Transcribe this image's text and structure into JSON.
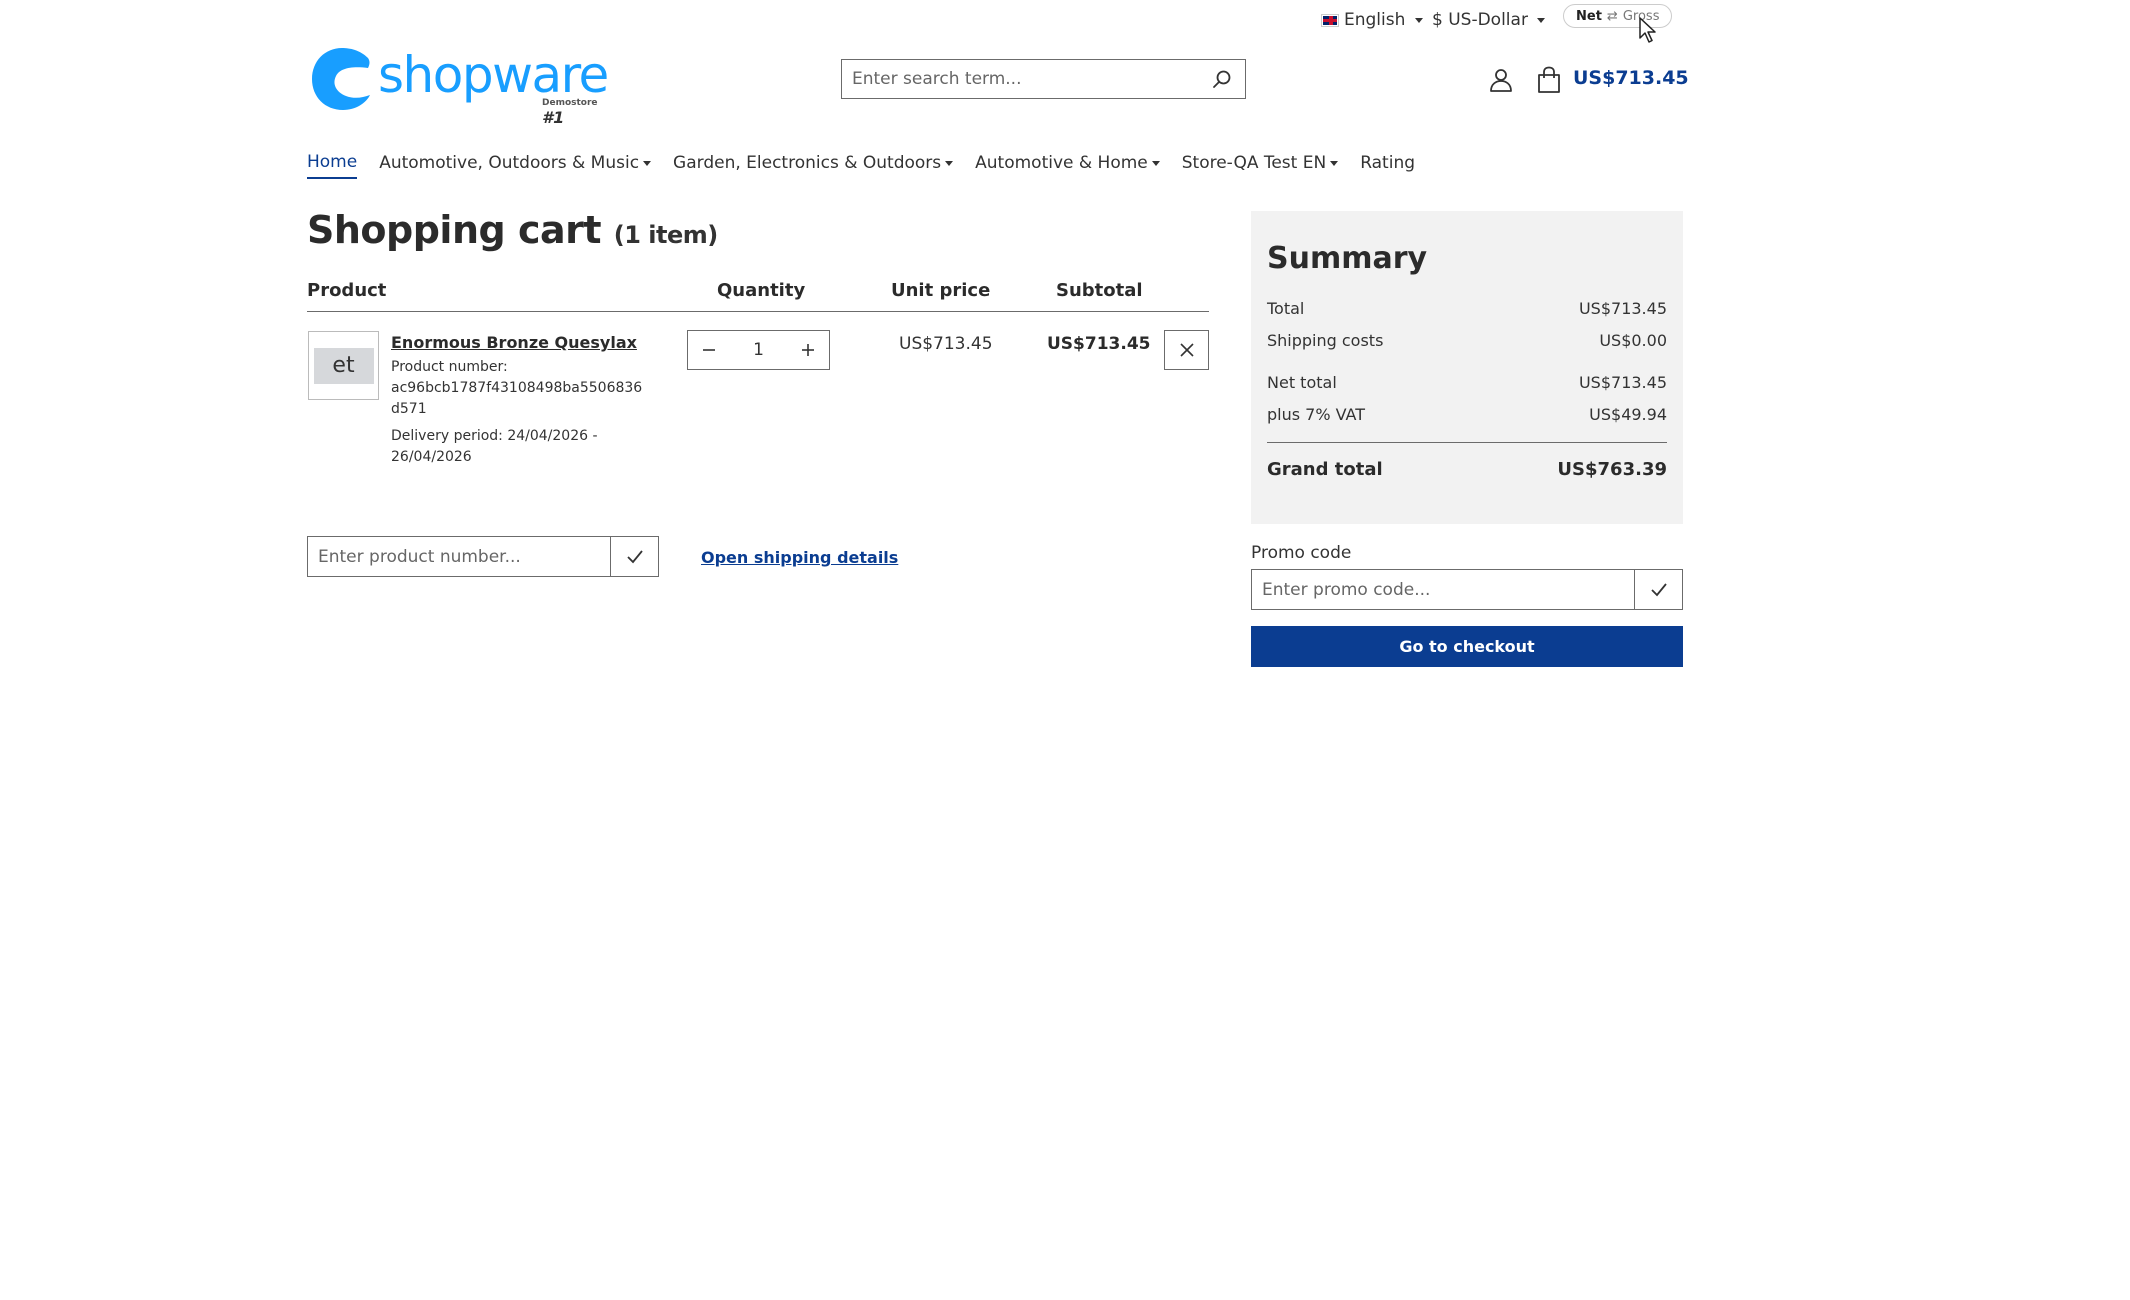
{
  "topbar": {
    "language": "English",
    "currency": "$ US-Dollar",
    "tax_toggle_net": "Net",
    "tax_toggle_sep": "⇄",
    "tax_toggle_gross": "Gross"
  },
  "header": {
    "logo_text": "shopware",
    "logo_sub": "Demostore",
    "logo_badge": "#1",
    "search_placeholder": "Enter search term...",
    "cart_total": "US$713.45"
  },
  "nav": {
    "items": [
      {
        "label": "Home"
      },
      {
        "label": "Automotive, Outdoors & Music"
      },
      {
        "label": "Garden, Electronics & Outdoors"
      },
      {
        "label": "Automotive & Home"
      },
      {
        "label": "Store-QA Test EN"
      },
      {
        "label": "Rating"
      }
    ]
  },
  "cart": {
    "title": "Shopping cart",
    "count": "(1 item)",
    "columns": {
      "product": "Product",
      "quantity": "Quantity",
      "unit_price": "Unit price",
      "subtotal": "Subtotal"
    },
    "items": [
      {
        "thumb_text": "et",
        "name": "Enormous Bronze Quesylax",
        "number_label": "Product number:",
        "number": "ac96bcb1787f43108498ba5506836d571",
        "delivery": "Delivery period: 24/04/2026 - 26/04/2026",
        "quantity": "1",
        "unit_price": "US$713.45",
        "subtotal": "US$713.45"
      }
    ],
    "add_product_placeholder": "Enter product number...",
    "shipping_link": "Open shipping details"
  },
  "summary": {
    "title": "Summary",
    "total_label": "Total",
    "total": "US$713.45",
    "shipping_label": "Shipping costs",
    "shipping": "US$0.00",
    "net_label": "Net total",
    "net": "US$713.45",
    "vat_label": "plus 7% VAT",
    "vat": "US$49.94",
    "grand_label": "Grand total",
    "grand": "US$763.39"
  },
  "promo": {
    "label": "Promo code",
    "placeholder": "Enter promo code..."
  },
  "checkout_label": "Go to checkout",
  "colors": {
    "brand_blue": "#189eff",
    "primary": "#0b3d91",
    "summary_bg": "#f2f2f2"
  }
}
